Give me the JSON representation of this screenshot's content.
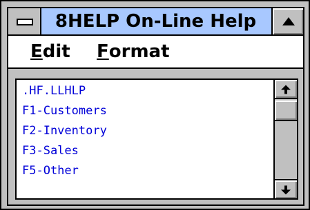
{
  "window": {
    "title": "8HELP On-Line Help",
    "title_bar_color": "#a8c8ff"
  },
  "system_menu": {
    "icon": "system-menu-icon"
  },
  "maximize": {
    "icon": "triangle-up-icon"
  },
  "menu": {
    "edit": {
      "mnemonic": "E",
      "rest": "dit"
    },
    "format": {
      "mnemonic": "F",
      "rest": "ormat"
    }
  },
  "list": {
    "text_color": "#0000d8",
    "items": [
      ".HF.LLHLP",
      "F1-Customers",
      "F2-Inventory",
      "F3-Sales",
      "F5-Other"
    ]
  },
  "scrollbar": {
    "up_icon": "arrow-up-icon",
    "down_icon": "arrow-down-icon",
    "thumb_position": 0.0
  }
}
